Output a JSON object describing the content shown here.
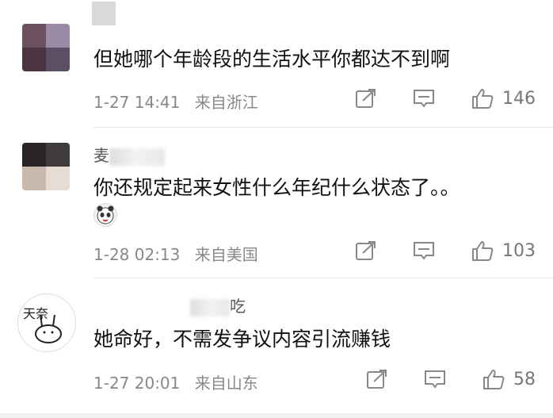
{
  "comments": [
    {
      "text": "但她哪个年龄段的生活水平你都达不到啊",
      "date": "1-27 14:41",
      "location": "来自浙江",
      "likes": "146"
    },
    {
      "username": "麦",
      "text": "你还规定起来女性什么年纪什么状态了。。",
      "date": "1-28 02:13",
      "location": "来自美国",
      "likes": "103"
    },
    {
      "username": "吃",
      "text": "她命好，不需发争议内容引流赚钱",
      "date": "1-27 20:01",
      "location": "来自山东",
      "likes": "58"
    }
  ],
  "icons": {
    "share": "share-icon",
    "comment": "comment-icon",
    "like": "thumbs-up-icon"
  },
  "colors": {
    "meta": "#888888",
    "text": "#111111",
    "divider": "#e8e8e8"
  }
}
